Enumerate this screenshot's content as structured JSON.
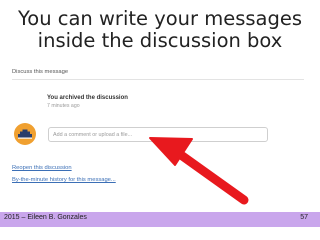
{
  "slide": {
    "title_line1": "You can write your messages",
    "title_line2": "inside the discussion box",
    "footer_left": "2015 – Eileen B. Gonzales",
    "page_number": "57",
    "footer_color": "#c9a6ec"
  },
  "discussion": {
    "header": "Discuss this message",
    "activity_title": "You archived the discussion",
    "activity_time": "7 minutes ago",
    "comment_placeholder": "Add a comment or upload a file...",
    "links": {
      "reopen": "Reopen this discussion",
      "history": "By-the-minute history for this message..."
    },
    "avatar_color": "#f0a030",
    "arrow_color": "#e8191e"
  }
}
